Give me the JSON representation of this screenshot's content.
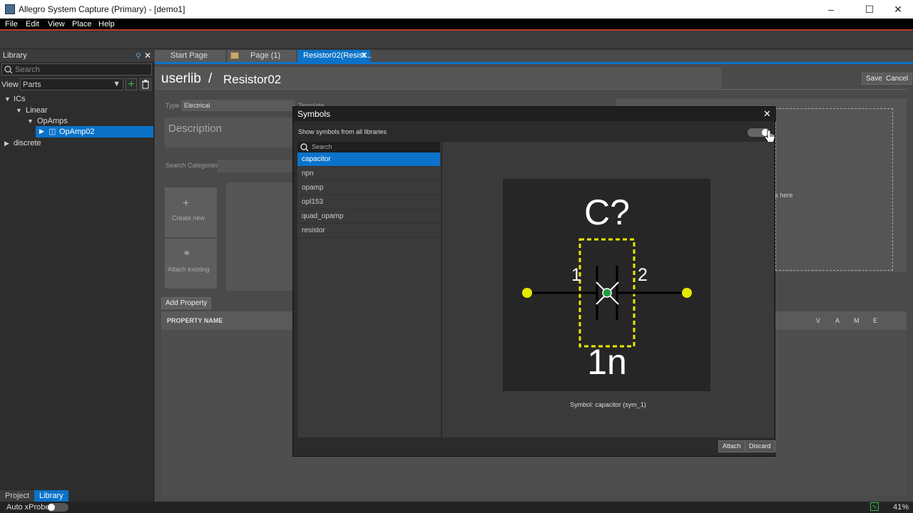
{
  "window": {
    "title": "Allegro System Capture (Primary) - [demo1]"
  },
  "menu": [
    "File",
    "Edit",
    "View",
    "Place",
    "Help"
  ],
  "library_panel": {
    "title": "Library",
    "search_placeholder": "Search",
    "view_label": "View",
    "view_value": "Parts",
    "tree": [
      "ICs",
      "Linear",
      "OpAmps",
      "OpAmp02",
      "discrete"
    ]
  },
  "bottom_tabs": [
    "Project",
    "Library"
  ],
  "status": {
    "auto_xprobe": "Auto xProbe",
    "zoom": "41%"
  },
  "doc_tabs": [
    "Start Page",
    "Page (1)",
    "Resistor02(Resist..."
  ],
  "editor": {
    "breadcrumb_lib": "userlib",
    "breadcrumb_sep": "/",
    "breadcrumb_part": "Resistor02",
    "save": "Save",
    "cancel": "Cancel",
    "type_label": "Type",
    "type_value": "Electrical",
    "template_label": "Template",
    "description": "Description",
    "search_categories": "Search Categories :",
    "create_new": "Create new",
    "attach_existing": "Attach existing",
    "add_property": "Add Property",
    "property_name_header": "PROPERTY NAME",
    "vame_headers": [
      "V",
      "A",
      "M",
      "E"
    ],
    "click_here": "ck here"
  },
  "symbols_dialog": {
    "title": "Symbols",
    "show_all_label": "Show symbols from all libraries",
    "search_placeholder": "Search",
    "items": [
      "capacitor",
      "npn",
      "opamp",
      "opl153",
      "quad_opamp",
      "resistor"
    ],
    "selected_index": 0,
    "preview": {
      "refdes": "C?",
      "pin1": "1",
      "pin2": "2",
      "value": "1n"
    },
    "caption": "Symbol: capacitor (sym_1)",
    "attach": "Attach",
    "discard": "Discard"
  },
  "colors": {
    "accent": "#0a73c9",
    "pin_dot": "#e8e800",
    "outline": "#e8e800",
    "origin": "#1e9e3e"
  }
}
